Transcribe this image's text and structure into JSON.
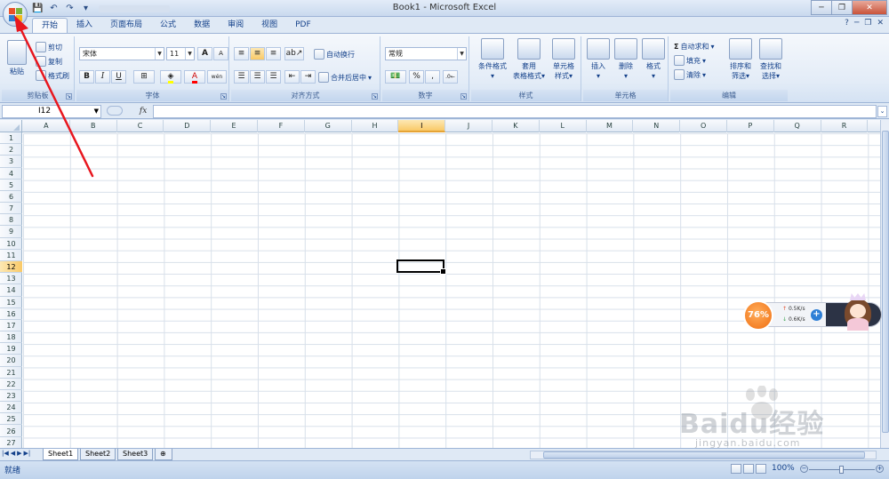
{
  "window": {
    "title": "Book1 - Microsoft Excel",
    "minimize": "─",
    "restore": "❐",
    "close": "✕"
  },
  "quick_access": {
    "save": "💾",
    "undo": "↶",
    "redo": "↷",
    "customize": "▾"
  },
  "tabs": [
    "开始",
    "插入",
    "页面布局",
    "公式",
    "数据",
    "审阅",
    "视图",
    "PDF"
  ],
  "active_tab": "开始",
  "help": {
    "help_icon": "?",
    "min": "─",
    "restore": "❐",
    "close": "✕"
  },
  "ribbon": {
    "clipboard": {
      "label": "剪贴板",
      "paste": "粘贴",
      "cut": "剪切",
      "copy": "复制",
      "format_painter": "格式刷"
    },
    "font": {
      "label": "字体",
      "font_name": "宋体",
      "font_size": "11",
      "grow": "A",
      "shrink": "A",
      "bold": "B",
      "italic": "I",
      "underline": "U",
      "wen": "wén"
    },
    "alignment": {
      "label": "对齐方式",
      "wrap_text": "自动换行",
      "merge_center": "合并后居中"
    },
    "number": {
      "label": "数字",
      "format": "常规",
      "percent": "%",
      "comma": ","
    },
    "styles": {
      "label": "样式",
      "conditional": "条件格式",
      "table_format_1": "套用",
      "table_format_2": "表格格式",
      "cell_styles_1": "单元格",
      "cell_styles_2": "样式"
    },
    "cells": {
      "label": "单元格",
      "insert": "插入",
      "delete": "删除",
      "format": "格式"
    },
    "editing": {
      "label": "编辑",
      "autosum": "自动求和",
      "sigma": "Σ",
      "fill": "填充",
      "clear": "清除",
      "sort_filter_1": "排序和",
      "sort_filter_2": "筛选",
      "find_select_1": "查找和",
      "find_select_2": "选择"
    }
  },
  "formula_bar": {
    "name_box": "I12",
    "fx": "fx",
    "value": ""
  },
  "grid": {
    "columns": [
      "A",
      "B",
      "C",
      "D",
      "E",
      "F",
      "G",
      "H",
      "I",
      "J",
      "K",
      "L",
      "M",
      "N",
      "O",
      "P",
      "Q",
      "R"
    ],
    "rows": [
      "1",
      "2",
      "3",
      "4",
      "5",
      "6",
      "7",
      "8",
      "9",
      "10",
      "11",
      "12",
      "13",
      "14",
      "15",
      "16",
      "17",
      "18",
      "19",
      "20",
      "21",
      "22",
      "23",
      "24",
      "25",
      "26",
      "27"
    ],
    "selected_column": "I",
    "selected_row": "12"
  },
  "sheets": [
    "Sheet1",
    "Sheet2",
    "Sheet3"
  ],
  "active_sheet": "Sheet1",
  "status": {
    "ready": "就绪",
    "zoom": "100%",
    "zoom_minus": "−",
    "zoom_plus": "+"
  },
  "speed_widget": {
    "percent": "76%",
    "upload": "0.5K/s",
    "download": "0.6K/s",
    "plus": "+",
    "up_arrow": "↑",
    "down_arrow": "↓"
  },
  "watermark": {
    "logo": "Baidu经验",
    "url": "jingyan.baidu.com"
  },
  "colors": {
    "accent": "#15428b",
    "ribbon_bg": "#e3ecf7",
    "selected_header": "#f9c967",
    "annotation_arrow": "#e8161e",
    "speed_orange": "#f06d10"
  },
  "icons": {
    "office_button": "office-logo-icon",
    "annotation": "red-arrow-icon"
  }
}
